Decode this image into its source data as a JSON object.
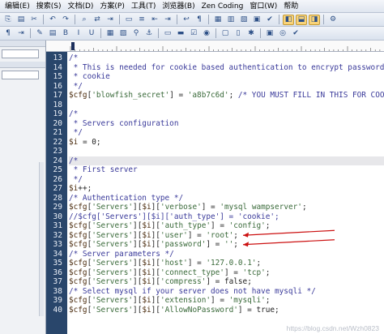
{
  "menu": [
    {
      "name": "menu-edit",
      "label": "编辑(E)"
    },
    {
      "name": "menu-search",
      "label": "搜索(S)"
    },
    {
      "name": "menu-document",
      "label": "文档(D)"
    },
    {
      "name": "menu-scheme",
      "label": "方案(P)"
    },
    {
      "name": "menu-tools",
      "label": "工具(T)"
    },
    {
      "name": "menu-browser",
      "label": "浏览器(B)"
    },
    {
      "name": "menu-zen-coding",
      "label": "Zen Coding"
    },
    {
      "name": "menu-window",
      "label": "窗口(W)"
    },
    {
      "name": "menu-help",
      "label": "帮助"
    }
  ],
  "toolbar_row1": [
    {
      "name": "copy-icon",
      "glyph": "⎘"
    },
    {
      "name": "paste-icon",
      "glyph": "▤"
    },
    {
      "name": "cut-icon",
      "glyph": "✂"
    },
    {
      "name": "sep"
    },
    {
      "name": "undo-icon",
      "glyph": "↶"
    },
    {
      "name": "redo-icon",
      "glyph": "↷"
    },
    {
      "name": "sep"
    },
    {
      "name": "find-icon",
      "glyph": "⌕"
    },
    {
      "name": "replace-icon",
      "glyph": "⇄"
    },
    {
      "name": "goto-icon",
      "glyph": "⇥"
    },
    {
      "name": "sep"
    },
    {
      "name": "block-icon",
      "glyph": "▭"
    },
    {
      "name": "list-icon",
      "glyph": "≡"
    },
    {
      "name": "indent-icon",
      "glyph": "⇤"
    },
    {
      "name": "outdent-icon",
      "glyph": "⇥"
    },
    {
      "name": "sep"
    },
    {
      "name": "wrap-icon",
      "glyph": "↩"
    },
    {
      "name": "whitespace-icon",
      "glyph": "¶"
    },
    {
      "name": "sep"
    },
    {
      "name": "window-split-icon",
      "glyph": "▦"
    },
    {
      "name": "window-tile-icon",
      "glyph": "▥"
    },
    {
      "name": "window-cascade-icon",
      "glyph": "▧"
    },
    {
      "name": "fullscreen-icon",
      "glyph": "▣"
    },
    {
      "name": "check-icon",
      "glyph": "✔"
    },
    {
      "name": "sep"
    },
    {
      "name": "panel-left-icon",
      "glyph": "◧",
      "active": true
    },
    {
      "name": "panel-bottom-icon",
      "glyph": "⬓",
      "active": true
    },
    {
      "name": "panel-right-icon",
      "glyph": "◨",
      "active": true
    },
    {
      "name": "sep"
    },
    {
      "name": "settings-icon",
      "glyph": "⚙"
    }
  ],
  "toolbar_row2": [
    {
      "name": "pilcrow-icon",
      "glyph": "¶"
    },
    {
      "name": "tab-stop-icon",
      "glyph": "⇥"
    },
    {
      "name": "sep"
    },
    {
      "name": "edit-tool-icon",
      "glyph": "✎"
    },
    {
      "name": "book-icon",
      "glyph": "▤"
    },
    {
      "name": "bold-icon",
      "glyph": "B"
    },
    {
      "name": "italic-icon",
      "glyph": "I"
    },
    {
      "name": "underline-icon",
      "glyph": "U"
    },
    {
      "name": "sep"
    },
    {
      "name": "table-icon",
      "glyph": "▦"
    },
    {
      "name": "image-icon",
      "glyph": "▨"
    },
    {
      "name": "link-icon",
      "glyph": "⚲"
    },
    {
      "name": "anchor-icon",
      "glyph": "⚓"
    },
    {
      "name": "sep"
    },
    {
      "name": "form-icon",
      "glyph": "▭"
    },
    {
      "name": "input-icon",
      "glyph": "▬"
    },
    {
      "name": "checkbox-icon",
      "glyph": "☑"
    },
    {
      "name": "radio-icon",
      "glyph": "◉"
    },
    {
      "name": "sep"
    },
    {
      "name": "div-icon",
      "glyph": "▢"
    },
    {
      "name": "span-icon",
      "glyph": "▯"
    },
    {
      "name": "comment-icon",
      "glyph": "✱"
    },
    {
      "name": "sep"
    },
    {
      "name": "preview-icon",
      "glyph": "▣"
    },
    {
      "name": "browser-icon",
      "glyph": "◎"
    },
    {
      "name": "validate-icon",
      "glyph": "✔"
    }
  ],
  "editor": {
    "current_line": 24,
    "lines": [
      {
        "n": "13",
        "tokens": [
          {
            "c": "comment",
            "t": "/*"
          }
        ]
      },
      {
        "n": "14",
        "tokens": [
          {
            "c": "comment",
            "t": " * This is needed for cookie based authentication to encrypt password in"
          }
        ]
      },
      {
        "n": "15",
        "tokens": [
          {
            "c": "comment",
            "t": " * cookie"
          }
        ]
      },
      {
        "n": "16",
        "tokens": [
          {
            "c": "comment",
            "t": " */"
          }
        ]
      },
      {
        "n": "17",
        "tokens": [
          {
            "c": "var",
            "t": "$cfg"
          },
          {
            "c": "plain",
            "t": "["
          },
          {
            "c": "key",
            "t": "'blowfish_secret'"
          },
          {
            "c": "plain",
            "t": "] = "
          },
          {
            "c": "key",
            "t": "'a8b7c6d'"
          },
          {
            "c": "plain",
            "t": "; "
          },
          {
            "c": "comment",
            "t": "/* YOU MUST FILL IN THIS FOR COOKIE A"
          }
        ]
      },
      {
        "n": "18",
        "tokens": []
      },
      {
        "n": "19",
        "tokens": [
          {
            "c": "comment",
            "t": "/*"
          }
        ]
      },
      {
        "n": "20",
        "tokens": [
          {
            "c": "comment",
            "t": " * Servers configuration"
          }
        ]
      },
      {
        "n": "21",
        "tokens": [
          {
            "c": "comment",
            "t": " */"
          }
        ]
      },
      {
        "n": "22",
        "tokens": [
          {
            "c": "var",
            "t": "$i"
          },
          {
            "c": "plain",
            "t": " = 0;"
          }
        ]
      },
      {
        "n": "23",
        "tokens": []
      },
      {
        "n": "24",
        "tokens": [
          {
            "c": "comment",
            "t": "/*"
          }
        ]
      },
      {
        "n": "25",
        "tokens": [
          {
            "c": "comment",
            "t": " * First server"
          }
        ]
      },
      {
        "n": "26",
        "tokens": [
          {
            "c": "comment",
            "t": " */"
          }
        ]
      },
      {
        "n": "27",
        "tokens": [
          {
            "c": "var",
            "t": "$i"
          },
          {
            "c": "plain",
            "t": "++;"
          }
        ]
      },
      {
        "n": "28",
        "tokens": [
          {
            "c": "comment",
            "t": "/* Authentication type */"
          }
        ]
      },
      {
        "n": "29",
        "tokens": [
          {
            "c": "var",
            "t": "$cfg"
          },
          {
            "c": "plain",
            "t": "["
          },
          {
            "c": "key",
            "t": "'Servers'"
          },
          {
            "c": "plain",
            "t": "]["
          },
          {
            "c": "var",
            "t": "$i"
          },
          {
            "c": "plain",
            "t": "]["
          },
          {
            "c": "key",
            "t": "'verbose'"
          },
          {
            "c": "plain",
            "t": "] = "
          },
          {
            "c": "key",
            "t": "'mysql wampserver'"
          },
          {
            "c": "plain",
            "t": ";"
          }
        ]
      },
      {
        "n": "30",
        "tokens": [
          {
            "c": "comment",
            "t": "//$cfg['Servers'][$i]['auth_type'] = 'cookie';"
          }
        ]
      },
      {
        "n": "31",
        "tokens": [
          {
            "c": "var",
            "t": "$cfg"
          },
          {
            "c": "plain",
            "t": "["
          },
          {
            "c": "key",
            "t": "'Servers'"
          },
          {
            "c": "plain",
            "t": "]["
          },
          {
            "c": "var",
            "t": "$i"
          },
          {
            "c": "plain",
            "t": "]["
          },
          {
            "c": "key",
            "t": "'auth_type'"
          },
          {
            "c": "plain",
            "t": "] = "
          },
          {
            "c": "key",
            "t": "'config'"
          },
          {
            "c": "plain",
            "t": ";"
          }
        ]
      },
      {
        "n": "32",
        "tokens": [
          {
            "c": "var",
            "t": "$cfg"
          },
          {
            "c": "plain",
            "t": "["
          },
          {
            "c": "key",
            "t": "'Servers'"
          },
          {
            "c": "plain",
            "t": "]["
          },
          {
            "c": "var",
            "t": "$i"
          },
          {
            "c": "plain",
            "t": "]["
          },
          {
            "c": "key",
            "t": "'user'"
          },
          {
            "c": "plain",
            "t": "] = "
          },
          {
            "c": "key",
            "t": "'root'"
          },
          {
            "c": "plain",
            "t": ";"
          }
        ]
      },
      {
        "n": "33",
        "tokens": [
          {
            "c": "var",
            "t": "$cfg"
          },
          {
            "c": "plain",
            "t": "["
          },
          {
            "c": "key",
            "t": "'Servers'"
          },
          {
            "c": "plain",
            "t": "]["
          },
          {
            "c": "var",
            "t": "$i"
          },
          {
            "c": "plain",
            "t": "]["
          },
          {
            "c": "key",
            "t": "'password'"
          },
          {
            "c": "plain",
            "t": "] = "
          },
          {
            "c": "key",
            "t": "''"
          },
          {
            "c": "plain",
            "t": ";"
          }
        ]
      },
      {
        "n": "34",
        "tokens": [
          {
            "c": "comment",
            "t": "/* Server parameters */"
          }
        ]
      },
      {
        "n": "35",
        "tokens": [
          {
            "c": "var",
            "t": "$cfg"
          },
          {
            "c": "plain",
            "t": "["
          },
          {
            "c": "key",
            "t": "'Servers'"
          },
          {
            "c": "plain",
            "t": "]["
          },
          {
            "c": "var",
            "t": "$i"
          },
          {
            "c": "plain",
            "t": "]["
          },
          {
            "c": "key",
            "t": "'host'"
          },
          {
            "c": "plain",
            "t": "] = "
          },
          {
            "c": "key",
            "t": "'127.0.0.1'"
          },
          {
            "c": "plain",
            "t": ";"
          }
        ]
      },
      {
        "n": "36",
        "tokens": [
          {
            "c": "var",
            "t": "$cfg"
          },
          {
            "c": "plain",
            "t": "["
          },
          {
            "c": "key",
            "t": "'Servers'"
          },
          {
            "c": "plain",
            "t": "]["
          },
          {
            "c": "var",
            "t": "$i"
          },
          {
            "c": "plain",
            "t": "]["
          },
          {
            "c": "key",
            "t": "'connect_type'"
          },
          {
            "c": "plain",
            "t": "] = "
          },
          {
            "c": "key",
            "t": "'tcp'"
          },
          {
            "c": "plain",
            "t": ";"
          }
        ]
      },
      {
        "n": "37",
        "tokens": [
          {
            "c": "var",
            "t": "$cfg"
          },
          {
            "c": "plain",
            "t": "["
          },
          {
            "c": "key",
            "t": "'Servers'"
          },
          {
            "c": "plain",
            "t": "]["
          },
          {
            "c": "var",
            "t": "$i"
          },
          {
            "c": "plain",
            "t": "]["
          },
          {
            "c": "key",
            "t": "'compress'"
          },
          {
            "c": "plain",
            "t": "] = false;"
          }
        ]
      },
      {
        "n": "38",
        "tokens": [
          {
            "c": "comment",
            "t": "/* Select mysql if your server does not have mysqli */"
          }
        ]
      },
      {
        "n": "39",
        "tokens": [
          {
            "c": "var",
            "t": "$cfg"
          },
          {
            "c": "plain",
            "t": "["
          },
          {
            "c": "key",
            "t": "'Servers'"
          },
          {
            "c": "plain",
            "t": "]["
          },
          {
            "c": "var",
            "t": "$i"
          },
          {
            "c": "plain",
            "t": "]["
          },
          {
            "c": "key",
            "t": "'extension'"
          },
          {
            "c": "plain",
            "t": "] = "
          },
          {
            "c": "key",
            "t": "'mysqli'"
          },
          {
            "c": "plain",
            "t": ";"
          }
        ]
      },
      {
        "n": "40",
        "tokens": [
          {
            "c": "var",
            "t": "$cfg"
          },
          {
            "c": "plain",
            "t": "["
          },
          {
            "c": "key",
            "t": "'Servers'"
          },
          {
            "c": "plain",
            "t": "]["
          },
          {
            "c": "var",
            "t": "$i"
          },
          {
            "c": "plain",
            "t": "]["
          },
          {
            "c": "key",
            "t": "'AllowNoPassword'"
          },
          {
            "c": "plain",
            "t": "] = true;"
          }
        ]
      }
    ]
  },
  "annotations": {
    "arrow_color": "#cc1111",
    "targets": [
      "32",
      "33"
    ]
  },
  "watermark": "https://blog.csdn.net/Wzh0823",
  "colors": {
    "gutter_bg": "#29466b",
    "comment": "#3a3a9a",
    "string": "#3a6a3a",
    "variable": "#4b2c0e"
  }
}
